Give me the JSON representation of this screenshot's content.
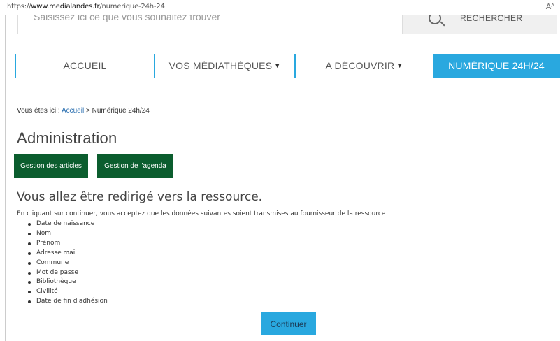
{
  "browser": {
    "url_prefix": "https://",
    "url_host": "www.medialandes.fr",
    "url_path": "/numerique-24h-24",
    "reader_icon": "Aᴬ"
  },
  "search": {
    "placeholder": "Saisissez ici ce que vous souhaitez trouver",
    "button_label": "RECHERCHER",
    "icon": "search-icon"
  },
  "nav": {
    "items": [
      {
        "label": "ACCUEIL"
      },
      {
        "label": "VOS MÉDIATHÈQUES",
        "caret": "▼"
      },
      {
        "label": "A DÉCOUVRIR",
        "caret": "▼"
      },
      {
        "label": "NUMÉRIQUE 24H/24"
      }
    ],
    "accent_color": "#29a8df"
  },
  "breadcrumb": {
    "prefix": "Vous êtes ici : ",
    "home": "Accueil",
    "separator": " > ",
    "current": "Numérique 24h/24"
  },
  "admin": {
    "title": "Administration",
    "buttons": [
      "Gestion des articles",
      "Gestion de l'agenda"
    ],
    "button_color": "#0b5d2e"
  },
  "redirect": {
    "title": "Vous allez être redirigé vers la ressource.",
    "text": "En cliquant sur continuer, vous acceptez que les données suivantes soient transmises au fournisseur de la ressource",
    "fields": [
      "Date de naissance",
      "Nom",
      "Prénom",
      "Adresse mail",
      "Commune",
      "Mot de passe",
      "Bibliothèque",
      "Civilité",
      "Date de fin d'adhésion"
    ],
    "continue_label": "Continuer"
  }
}
